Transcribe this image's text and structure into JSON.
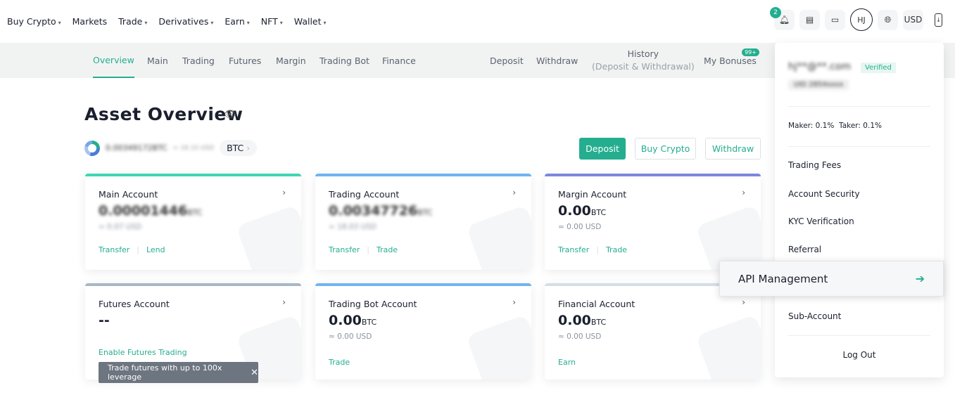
{
  "topnav": {
    "items": [
      {
        "label": "Buy Crypto",
        "dropdown": true
      },
      {
        "label": "Markets",
        "dropdown": false
      },
      {
        "label": "Trade",
        "dropdown": true
      },
      {
        "label": "Derivatives",
        "dropdown": true
      },
      {
        "label": "Earn",
        "dropdown": true
      },
      {
        "label": "NFT",
        "dropdown": true
      },
      {
        "label": "Wallet",
        "dropdown": true
      }
    ],
    "notif_count": "2",
    "avatar": "HJ",
    "currency": "USD"
  },
  "subnav": {
    "tabs": [
      "Overview",
      "Main",
      "Trading",
      "Futures",
      "Margin",
      "Trading Bot",
      "Finance"
    ],
    "active": "Overview",
    "deposit": "Deposit",
    "withdraw": "Withdraw",
    "history": "History",
    "history_sub": "(Deposit & Withdrawal)",
    "bonuses": "My Bonuses",
    "bonus_badge": "99+"
  },
  "overview": {
    "title": "Asset Overview",
    "total": "0.00349172BTC",
    "total_usd": "≈ 18.10 USD",
    "unit": "BTC",
    "deposit": "Deposit",
    "buy": "Buy Crypto",
    "withdraw": "Withdraw"
  },
  "cards": [
    {
      "title": "Main Account",
      "amount": "0.00001446",
      "unit": "BTC",
      "usd": "≈ 0.07 USD",
      "actions": [
        "Transfer",
        "Lend"
      ],
      "bar": "#3fd6b4",
      "blurred": true
    },
    {
      "title": "Trading Account",
      "amount": "0.00347726",
      "unit": "BTC",
      "usd": "≈ 18.03 USD",
      "actions": [
        "Transfer",
        "Trade"
      ],
      "bar": "#6fb4f0",
      "blurred": true
    },
    {
      "title": "Margin Account",
      "amount": "0.00",
      "unit": "BTC",
      "usd": "≈ 0.00 USD",
      "actions": [
        "Transfer",
        "Trade"
      ],
      "bar": "#7c87dd"
    },
    {
      "title": "Futures Account",
      "amount": "--",
      "unit": "",
      "usd": "",
      "actions": [
        "Enable Futures Trading"
      ],
      "bar": "#a9b7c8"
    },
    {
      "title": "Trading Bot Account",
      "amount": "0.00",
      "unit": "BTC",
      "usd": "≈ 0.00 USD",
      "actions": [
        "Trade"
      ],
      "bar": "#6fb4f0"
    },
    {
      "title": "Financial Account",
      "amount": "0.00",
      "unit": "BTC",
      "usd": "≈ 0.00 USD",
      "actions": [
        "Earn"
      ],
      "bar": "#d5dde6"
    }
  ],
  "tooltip": "Trade futures with up to 100x leverage",
  "dropdown": {
    "email": "hj**@**.com",
    "verified": "Verified",
    "uid": "UID 2854xxxx",
    "fees": "Maker: 0.1%  Taker: 0.1%",
    "items": [
      "Trading Fees",
      "Account Security",
      "KYC Verification",
      "Referral",
      "Sub-Account"
    ],
    "api": "API Management",
    "logout": "Log Out"
  }
}
